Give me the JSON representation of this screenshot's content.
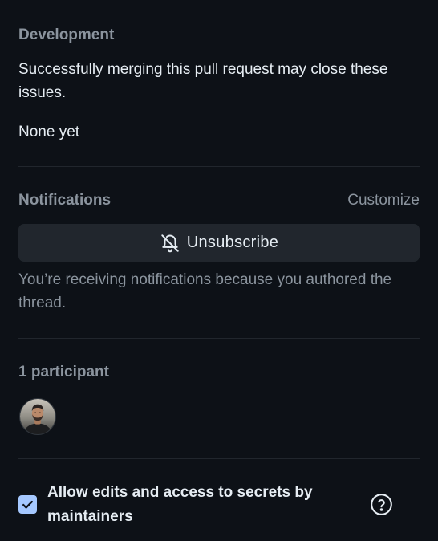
{
  "development": {
    "heading": "Development",
    "description": "Successfully merging this pull request may close these issues.",
    "linked_issues": "None yet"
  },
  "notifications": {
    "heading": "Notifications",
    "customize_label": "Customize",
    "unsubscribe_label": "Unsubscribe",
    "reason": "You’re receiving notifications because you authored the thread."
  },
  "participants": {
    "heading": "1 participant",
    "count": 1
  },
  "maintainer_edits": {
    "label": "Allow edits and access to secrets by maintainers",
    "checked": true
  },
  "icons": {
    "unsubscribe": "bell-slash-icon",
    "checkbox": "checkmark-icon",
    "help": "question-circle-icon"
  },
  "colors": {
    "background": "#0d1117",
    "button_background": "#21262d",
    "muted_text": "#8b949e",
    "primary_text": "#e6edf3",
    "checkbox_fill": "#a5c8ff"
  }
}
